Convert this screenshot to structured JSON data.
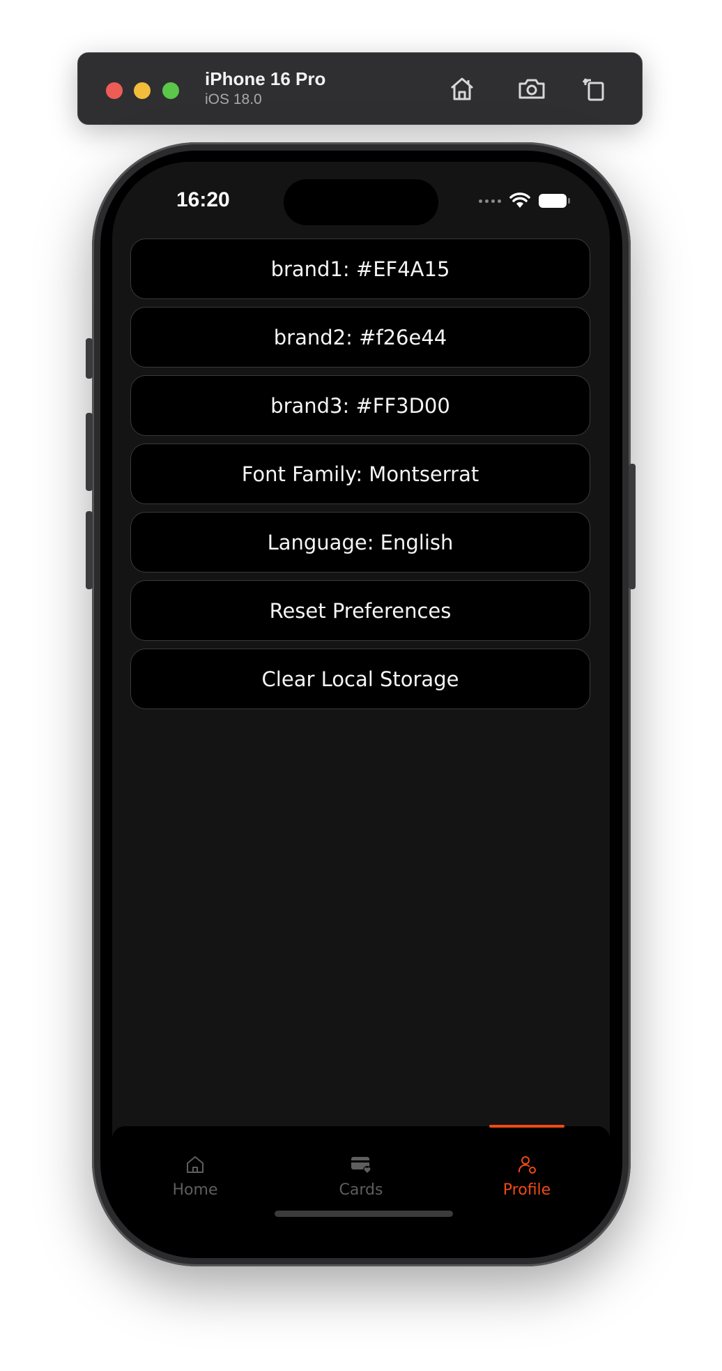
{
  "simulator": {
    "device_name": "iPhone 16 Pro",
    "os_version": "iOS 18.0",
    "controls": [
      "home-icon",
      "screenshot-icon",
      "rotate-icon"
    ]
  },
  "status_bar": {
    "time": "16:20"
  },
  "settings": {
    "items": [
      {
        "label": "brand1: #EF4A15"
      },
      {
        "label": "brand2: #f26e44"
      },
      {
        "label": "brand3: #FF3D00"
      },
      {
        "label": "Font Family: Montserrat"
      },
      {
        "label": "Language: English"
      },
      {
        "label": "Reset Preferences"
      },
      {
        "label": "Clear Local Storage"
      }
    ]
  },
  "tab_bar": {
    "tabs": [
      {
        "label": "Home",
        "icon": "home-icon",
        "active": false
      },
      {
        "label": "Cards",
        "icon": "card-icon",
        "active": false
      },
      {
        "label": "Profile",
        "icon": "profile-icon",
        "active": true
      }
    ]
  },
  "colors": {
    "accent": "#EF4A15",
    "background": "#141414",
    "button_bg": "#000000",
    "inactive_tab": "#5e5e5e"
  }
}
